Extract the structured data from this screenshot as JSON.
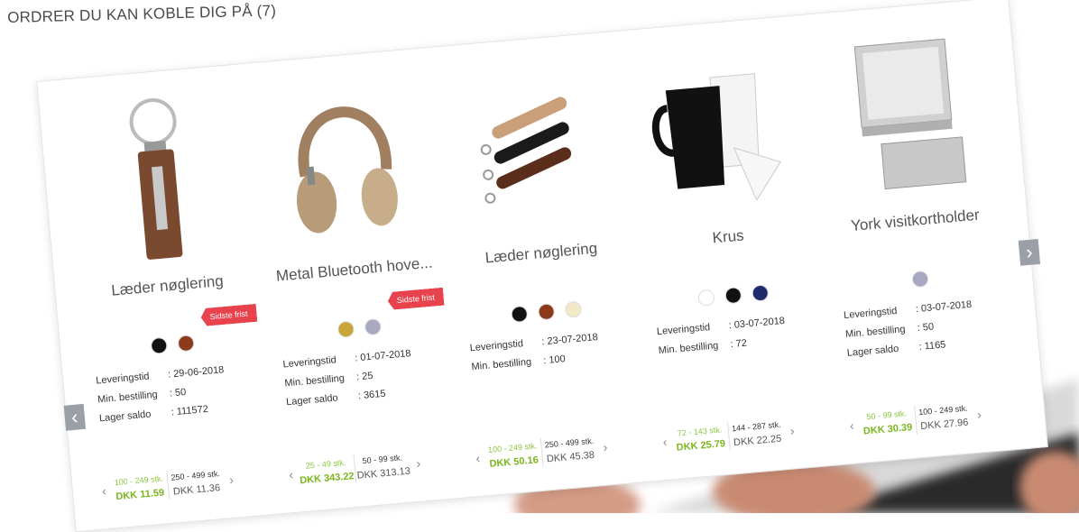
{
  "page": {
    "title": "ORDRER DU KAN KOBLE DIG PÅ (7)"
  },
  "labels": {
    "lev": "Leveringstid",
    "min": "Min. bestilling",
    "lager": "Lager saldo"
  },
  "products": [
    {
      "name": "Læder nøglering",
      "badge": "Sidste frist",
      "swatches": [
        "#111111",
        "#8b3a1a"
      ],
      "lev": ": 29-06-2018",
      "min": ": 50",
      "lager": ": 111572",
      "tiers": [
        {
          "range": "100 - 249 stk.",
          "price": "DKK 11.59"
        },
        {
          "range": "250 - 499 stk.",
          "price": "DKK 11.36"
        }
      ]
    },
    {
      "name": "Metal Bluetooth hove...",
      "badge": "Sidste frist",
      "swatches": [
        "#c9a53b",
        "#a8a8c0"
      ],
      "lev": ": 01-07-2018",
      "min": ": 25",
      "lager": ": 3615",
      "tiers": [
        {
          "range": "25 - 49 stk.",
          "price": "DKK 343.22"
        },
        {
          "range": "50 - 99 stk.",
          "price": "DKK 313.13"
        }
      ]
    },
    {
      "name": "Læder nøglering",
      "badge": "",
      "swatches": [
        "#111111",
        "#8b3a1a",
        "#f3e8c8"
      ],
      "lev": ": 23-07-2018",
      "min": ": 100",
      "lager": "",
      "tiers": [
        {
          "range": "100 - 249 stk.",
          "price": "DKK 50.16"
        },
        {
          "range": "250 - 499 stk.",
          "price": "DKK 45.38"
        }
      ]
    },
    {
      "name": "Krus",
      "badge": "",
      "swatches": [
        "#ffffff",
        "#111111",
        "#1f2a6b"
      ],
      "lev": ": 03-07-2018",
      "min": ": 72",
      "lager": "",
      "tiers": [
        {
          "range": "72 - 143 stk.",
          "price": "DKK 25.79"
        },
        {
          "range": "144 - 287 stk.",
          "price": "DKK 22.25"
        }
      ]
    },
    {
      "name": "York visitkortholder",
      "badge": "",
      "swatches": [
        "#a8a8c0"
      ],
      "lev": ": 03-07-2018",
      "min": ": 50",
      "lager": ": 1165",
      "tiers": [
        {
          "range": "50 - 99 stk.",
          "price": "DKK 30.39"
        },
        {
          "range": "100 - 249 stk.",
          "price": "DKK 27.96"
        }
      ]
    }
  ]
}
